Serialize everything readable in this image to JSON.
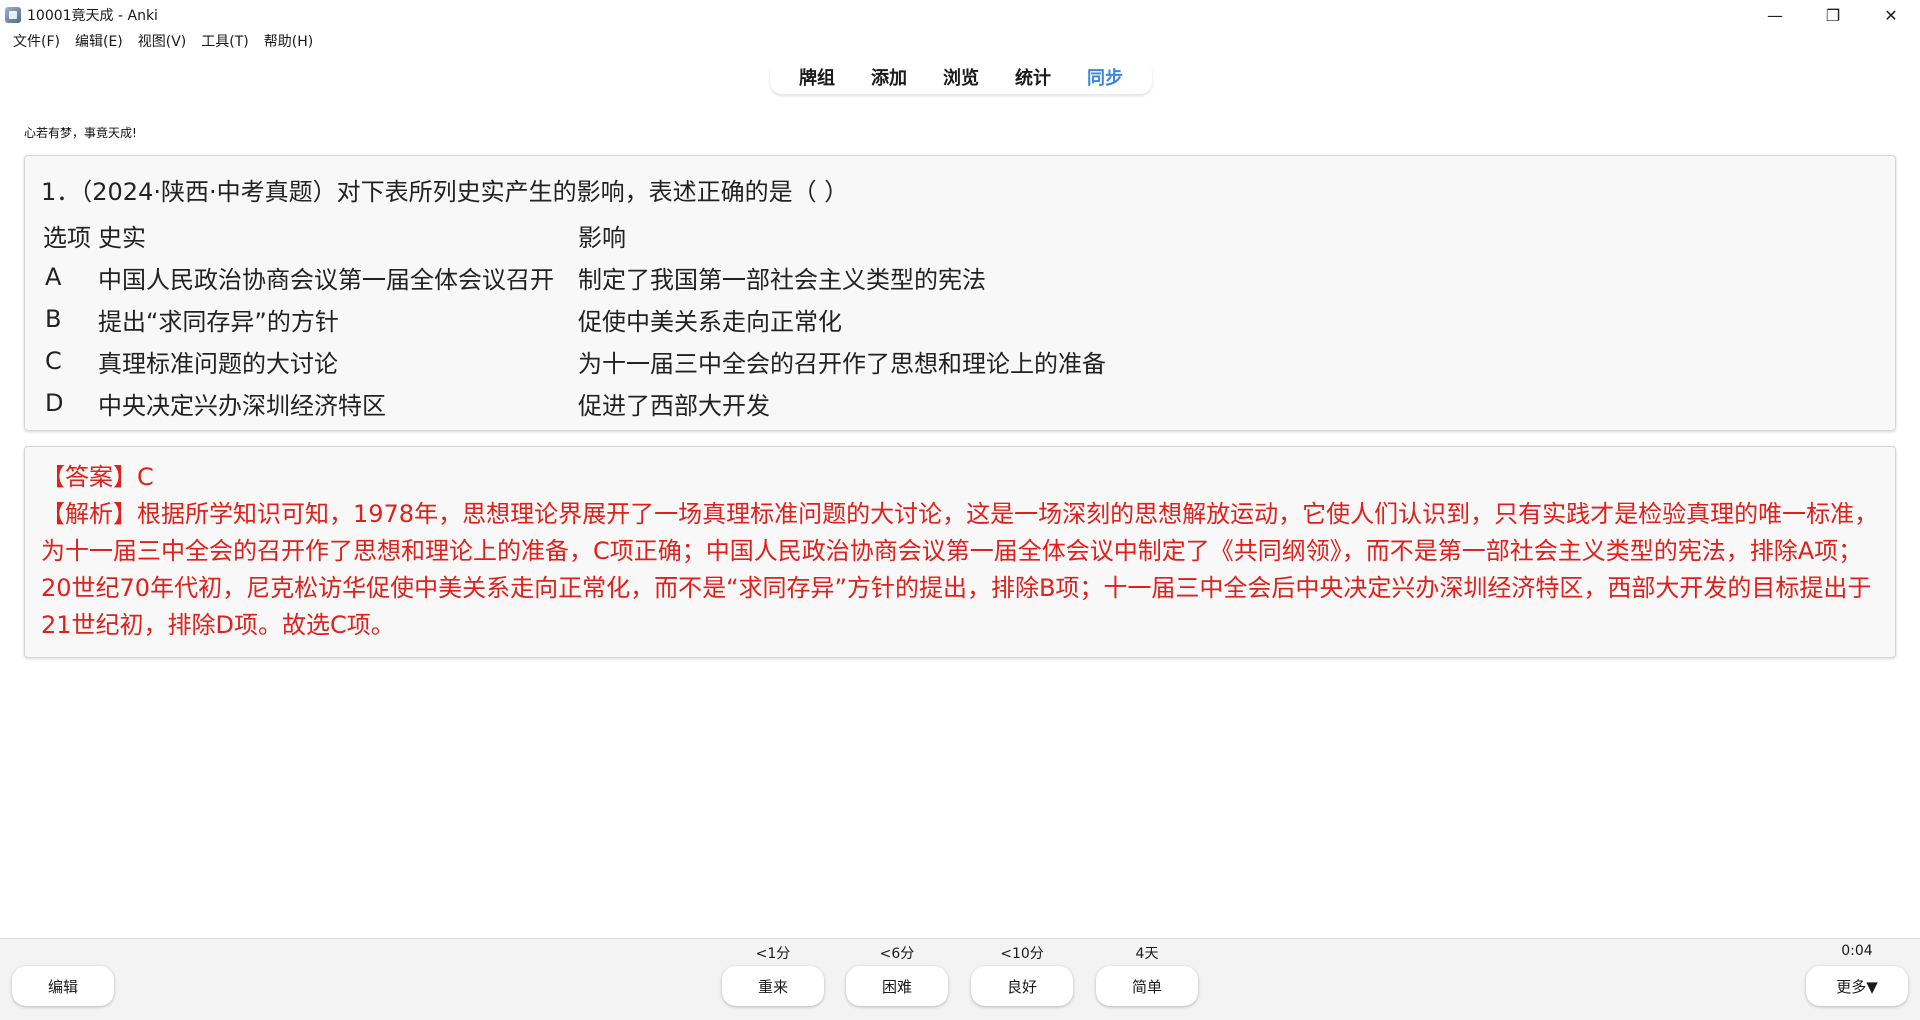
{
  "window": {
    "title": "10001竟天成 - Anki",
    "controls": {
      "minimize": "—",
      "maximize": "❐",
      "close": "✕"
    }
  },
  "menu": [
    "文件(F)",
    "编辑(E)",
    "视图(V)",
    "工具(T)",
    "帮助(H)"
  ],
  "toolbar": {
    "tabs": [
      {
        "label": "牌组",
        "active": false
      },
      {
        "label": "添加",
        "active": false
      },
      {
        "label": "浏览",
        "active": false
      },
      {
        "label": "统计",
        "active": false
      },
      {
        "label": "同步",
        "active": true
      }
    ],
    "active_color": "#3b86e0"
  },
  "motto": "心若有梦，事竟天成!",
  "question": {
    "text": "1．（2024·陕西·中考真题）对下表所列史实产生的影响，表述正确的是（    ）",
    "headers": [
      "选项",
      "史实",
      "影响"
    ],
    "rows": [
      {
        "option": "A",
        "fact": "中国人民政治协商会议第一届全体会议召开",
        "impact": "制定了我国第一部社会主义类型的宪法"
      },
      {
        "option": "B",
        "fact": "提出“求同存异”的方针",
        "impact": "促使中美关系走向正常化"
      },
      {
        "option": "C",
        "fact": "真理标准问题的大讨论",
        "impact": "为十一届三中全会的召开作了思想和理论上的准备"
      },
      {
        "option": "D",
        "fact": "中央决定兴办深圳经济特区",
        "impact": "促进了西部大开发"
      }
    ]
  },
  "answer": {
    "label": "【答案】C",
    "analysis": "【解析】根据所学知识可知，1978年，思想理论界展开了一场真理标准问题的大讨论，这是一场深刻的思想解放运动，它使人们认识到，只有实践才是检验真理的唯一标准，为十一届三中全会的召开作了思想和理论上的准备，C项正确；中国人民政治协商会议第一届全体会议中制定了《共同纲领》，而不是第一部社会主义类型的宪法，排除A项；20世纪70年代初，尼克松访华促使中美关系走向正常化，而不是“求同存异”方针的提出，排除B项；十一届三中全会后中央决定兴办深圳经济特区，西部大开发的目标提出于21世纪初，排除D项。故选C项。",
    "color": "#e0201a"
  },
  "bottom": {
    "edit_label": "编辑",
    "timer": "0:04",
    "more_label": "更多▼",
    "answers": [
      {
        "interval": "<1分",
        "label": "重来"
      },
      {
        "interval": "<6分",
        "label": "困难"
      },
      {
        "interval": "<10分",
        "label": "良好"
      },
      {
        "interval": "4天",
        "label": "简单"
      }
    ]
  }
}
